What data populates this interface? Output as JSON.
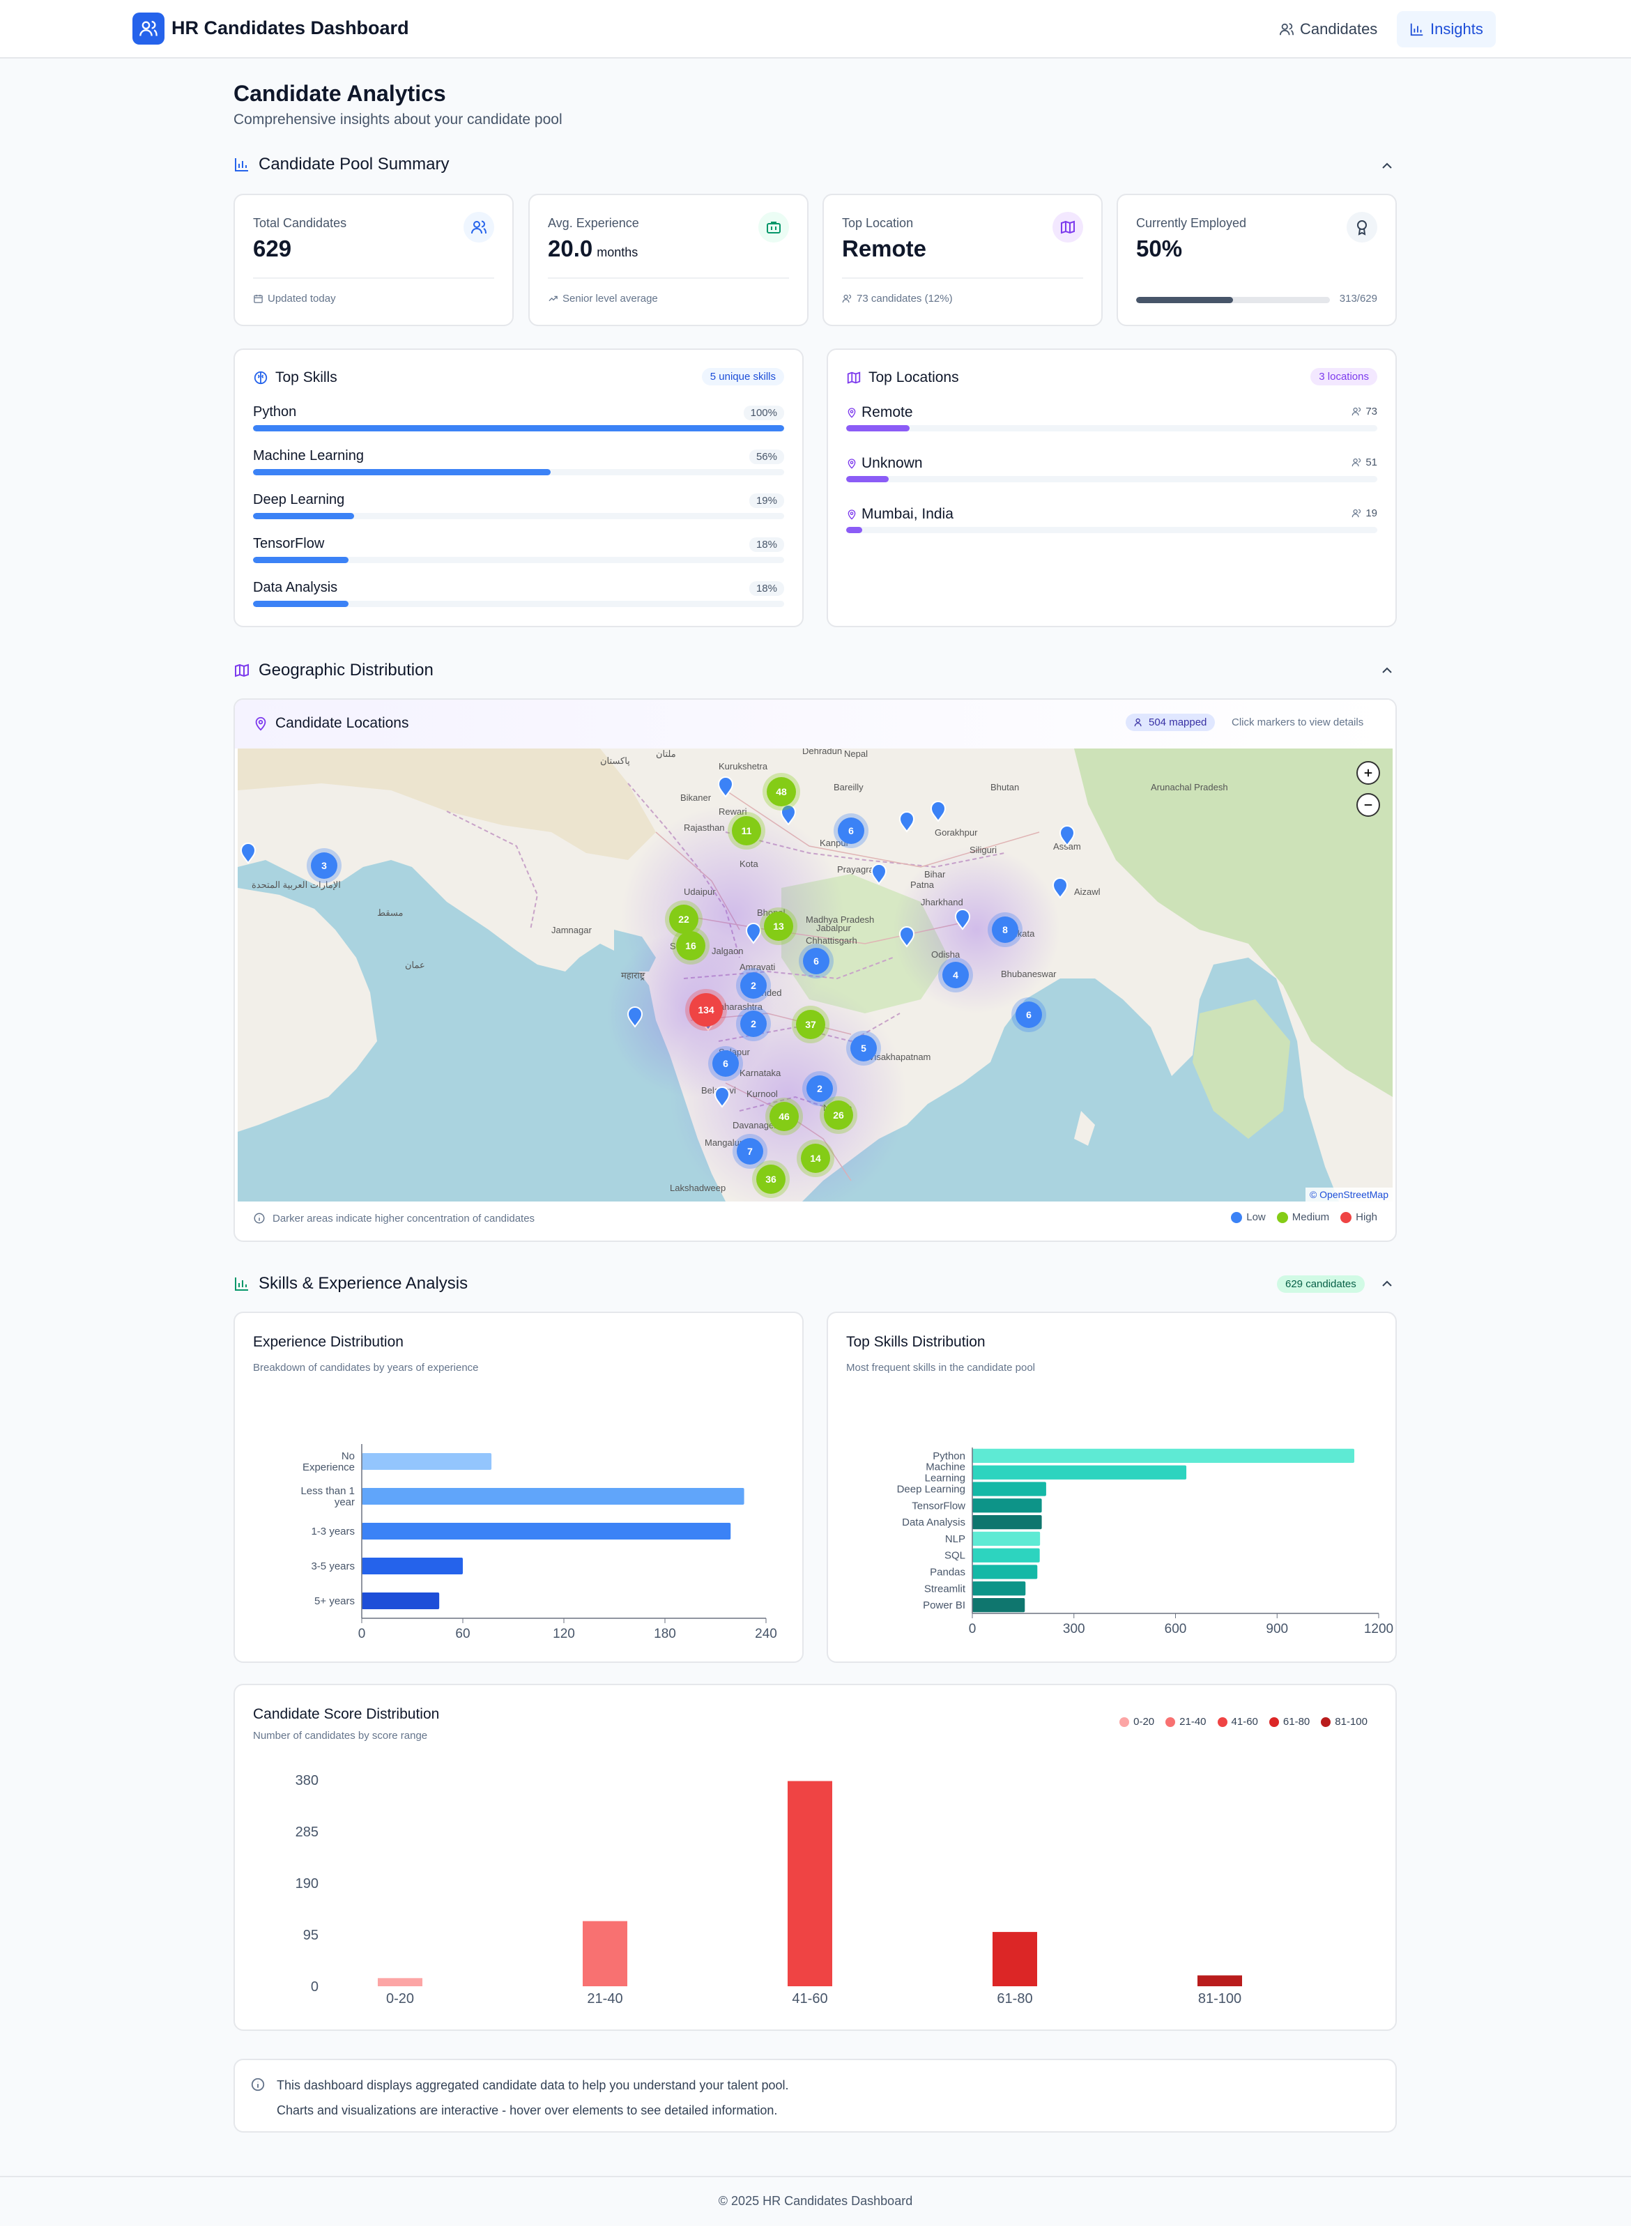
{
  "app": {
    "title": "HR Candidates Dashboard",
    "nav": [
      {
        "label": "Candidates",
        "active": false
      },
      {
        "label": "Insights",
        "active": true
      }
    ]
  },
  "page": {
    "title": "Candidate Analytics",
    "subtitle": "Comprehensive insights about your candidate pool"
  },
  "summary": {
    "section_title": "Candidate Pool Summary",
    "total": {
      "label": "Total Candidates",
      "value": "629",
      "footer": "Updated today",
      "icon": "users-icon"
    },
    "experience": {
      "label": "Avg. Experience",
      "value": "20.0",
      "unit": "months",
      "footer": "Senior level average",
      "icon": "briefcase-icon"
    },
    "location": {
      "label": "Top Location",
      "value": "Remote",
      "footer": "73 candidates (12%)",
      "icon": "map-icon"
    },
    "employed": {
      "label": "Currently Employed",
      "value": "50%",
      "progress": 0.5,
      "footer": "313/629",
      "icon": "award-icon"
    }
  },
  "top_skills": {
    "title": "Top Skills",
    "badge": "5 unique skills",
    "items": [
      {
        "name": "Python",
        "pct": "100%",
        "value": 1.0
      },
      {
        "name": "Machine Learning",
        "pct": "56%",
        "value": 0.56
      },
      {
        "name": "Deep Learning",
        "pct": "19%",
        "value": 0.19
      },
      {
        "name": "TensorFlow",
        "pct": "18%",
        "value": 0.18
      },
      {
        "name": "Data Analysis",
        "pct": "18%",
        "value": 0.18
      }
    ]
  },
  "top_locations": {
    "title": "Top Locations",
    "badge": "3 locations",
    "items": [
      {
        "name": "Remote",
        "count": "73",
        "value": 0.12
      },
      {
        "name": "Unknown",
        "count": "51",
        "value": 0.08
      },
      {
        "name": "Mumbai, India",
        "count": "19",
        "value": 0.03
      }
    ]
  },
  "geo": {
    "section_title": "Geographic Distribution",
    "card_title": "Candidate Locations",
    "badge": "504 mapped",
    "hint": "Click markers to view details",
    "attribution": "© OpenStreetMap",
    "note": "Darker areas indicate higher concentration of candidates",
    "legend": [
      {
        "label": "Low",
        "color": "#3b82f6"
      },
      {
        "label": "Medium",
        "color": "#84cc16"
      },
      {
        "label": "High",
        "color": "#ef4444"
      }
    ],
    "map_labels": [
      "ملتان",
      "پاکستان",
      "Dehradun",
      "Kurukshetra",
      "Bikaner",
      "Rewari",
      "Bareilly",
      "Kanpur",
      "Gorakhpur",
      "Siliguri",
      "Prayagraj",
      "Patna",
      "Kota",
      "Udaipur",
      "Bhopal",
      "Jabalpur",
      "Jamnagar",
      "Surat",
      "Jalgaon",
      "Amravati",
      "Nanded",
      "Bhubaneswar",
      "Kolkata",
      "Solapur",
      "Belagavi",
      "Kurnool",
      "Nellore",
      "Mangaluru",
      "Visakhapatnam",
      "Davanagere",
      "Lakshadweep",
      "Madhya Pradesh",
      "Chhattisgarh",
      "Maharashtra",
      "Karnataka",
      "Jharkhand",
      "Odisha",
      "Bihar",
      "Rajasthan",
      "Assam",
      "Aizawl",
      "Arunachal Pradesh",
      "Nepal",
      "Bhutan",
      "الإمارات العربية المتحدة",
      "مسقط",
      "عمان",
      "महाराष्ट्र"
    ],
    "clusters": [
      {
        "n": "48",
        "level": "medium"
      },
      {
        "n": "11",
        "level": "medium"
      },
      {
        "n": "6",
        "level": "low"
      },
      {
        "n": "3",
        "level": "low"
      },
      {
        "n": "22",
        "level": "medium"
      },
      {
        "n": "16",
        "level": "medium"
      },
      {
        "n": "13",
        "level": "medium"
      },
      {
        "n": "8",
        "level": "low"
      },
      {
        "n": "6",
        "level": "low"
      },
      {
        "n": "2",
        "level": "low"
      },
      {
        "n": "4",
        "level": "low"
      },
      {
        "n": "134",
        "level": "high"
      },
      {
        "n": "2",
        "level": "low"
      },
      {
        "n": "37",
        "level": "medium"
      },
      {
        "n": "6",
        "level": "low"
      },
      {
        "n": "5",
        "level": "low"
      },
      {
        "n": "6",
        "level": "low"
      },
      {
        "n": "2",
        "level": "low"
      },
      {
        "n": "46",
        "level": "medium"
      },
      {
        "n": "26",
        "level": "medium"
      },
      {
        "n": "7",
        "level": "low"
      },
      {
        "n": "14",
        "level": "medium"
      },
      {
        "n": "36",
        "level": "medium"
      }
    ]
  },
  "analysis": {
    "section_title": "Skills & Experience Analysis",
    "badge": "629 candidates"
  },
  "chart_data": [
    {
      "type": "bar",
      "orientation": "horizontal",
      "title": "Experience Distribution",
      "subtitle": "Breakdown of candidates by years of experience",
      "categories": [
        "No Experience",
        "Less than 1 year",
        "1-3 years",
        "3-5 years",
        "5+ years"
      ],
      "values": [
        77,
        227,
        219,
        60,
        46
      ],
      "xlim": [
        0,
        240
      ],
      "xticks": [
        0,
        60,
        120,
        180,
        240
      ],
      "colors": [
        "#93c5fd",
        "#60a5fa",
        "#3b82f6",
        "#2563eb",
        "#1d4ed8"
      ]
    },
    {
      "type": "bar",
      "orientation": "horizontal",
      "title": "Top Skills Distribution",
      "subtitle": "Most frequent skills in the candidate pool",
      "categories": [
        "Python",
        "Machine Learning",
        "Deep Learning",
        "TensorFlow",
        "Data Analysis",
        "NLP",
        "SQL",
        "Pandas",
        "Streamlit",
        "Power BI"
      ],
      "values": [
        1128,
        632,
        218,
        205,
        205,
        200,
        199,
        192,
        157,
        155
      ],
      "xlim": [
        0,
        1200
      ],
      "xticks": [
        0,
        300,
        600,
        900,
        1200
      ],
      "colors": [
        "#5eead4",
        "#2dd4bf",
        "#14b8a6",
        "#0d9488",
        "#0f766e",
        "#5eead4",
        "#2dd4bf",
        "#14b8a6",
        "#0d9488",
        "#0f766e"
      ]
    },
    {
      "type": "bar",
      "title": "Candidate Score Distribution",
      "subtitle": "Number of candidates by score range",
      "categories": [
        "0-20",
        "21-40",
        "41-60",
        "61-80",
        "81-100"
      ],
      "values": [
        15,
        120,
        378,
        100,
        20
      ],
      "ylim": [
        0,
        380
      ],
      "yticks": [
        0,
        95,
        190,
        285,
        380
      ],
      "colors": [
        "#fca5a5",
        "#f87171",
        "#ef4444",
        "#dc2626",
        "#b91c1c"
      ]
    }
  ],
  "footer_note": {
    "line1": "This dashboard displays aggregated candidate data to help you understand your talent pool.",
    "line2": "Charts and visualizations are interactive - hover over elements to see detailed information."
  },
  "copyright": "© 2025 HR Candidates Dashboard"
}
